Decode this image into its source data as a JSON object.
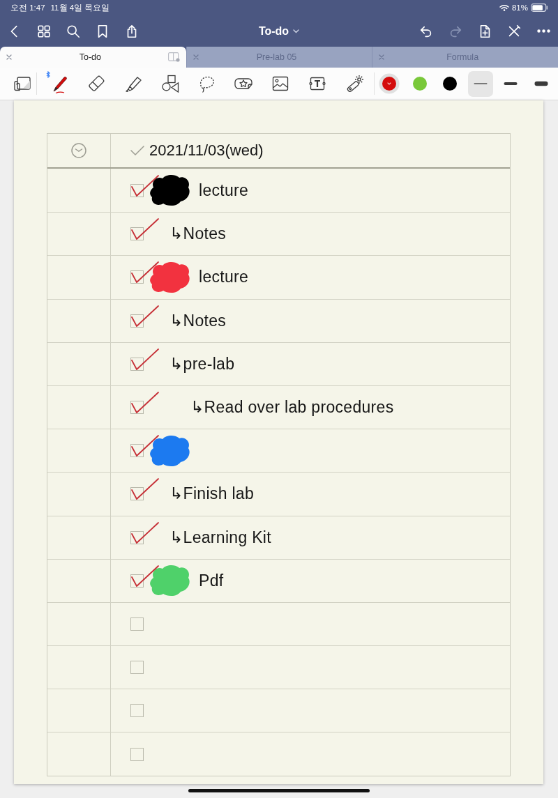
{
  "status_bar": {
    "time": "오전 1:47",
    "date": "11월 4일 목요일",
    "battery": "81%"
  },
  "nav_bar": {
    "title": "To-do",
    "undo": {
      "disabled": false
    },
    "redo": {
      "disabled": true
    }
  },
  "tabs": [
    {
      "label": "To-do",
      "selected": true
    },
    {
      "label": "Pre-lab 05",
      "selected": false
    },
    {
      "label": "Formula",
      "selected": false
    }
  ],
  "toolbar": {
    "tools": [
      {
        "kind": "pen",
        "selected": true
      },
      {
        "kind": "eraser",
        "selected": false
      },
      {
        "kind": "highlighter",
        "selected": false
      },
      {
        "kind": "shapes",
        "selected": false
      },
      {
        "kind": "lasso",
        "selected": false
      },
      {
        "kind": "sticker",
        "selected": false
      },
      {
        "kind": "image",
        "selected": false
      },
      {
        "kind": "text",
        "selected": false
      },
      {
        "kind": "laser",
        "selected": false
      }
    ],
    "colors": [
      {
        "color": "#d40c0c",
        "selected": true
      },
      {
        "color": "#79c83a",
        "selected": false
      },
      {
        "color": "#000000",
        "selected": false
      }
    ],
    "stroke_widths": [
      {
        "selected": true
      },
      {
        "selected": false
      },
      {
        "selected": false
      }
    ]
  },
  "page": {
    "header": {
      "date": "2021/11/03(wed)"
    },
    "tasks": [
      {
        "checked": true,
        "scribble": {
          "color": "#000000"
        },
        "text": "lecture",
        "children": [
          {
            "checked": true,
            "text": "↳Notes"
          }
        ]
      },
      {
        "checked": true,
        "scribble": {
          "color": "#f2323f"
        },
        "text": "lecture",
        "children": [
          {
            "checked": true,
            "text": "↳Notes"
          },
          {
            "checked": true,
            "text": "↳pre-lab",
            "children": [
              {
                "checked": true,
                "text": "↳Read over lab procedures"
              }
            ]
          }
        ]
      },
      {
        "checked": true,
        "scribble": {
          "color": "#1c7af0"
        },
        "children": [
          {
            "checked": true,
            "text": "↳Finish lab"
          },
          {
            "checked": true,
            "text": "↳Learning Kit"
          }
        ]
      },
      {
        "checked": true,
        "scribble": {
          "color": "#4fd16a"
        },
        "text": "Pdf"
      }
    ],
    "blank_rows": [
      {
        "checked": false
      },
      {
        "checked": false
      },
      {
        "checked": false
      },
      {
        "checked": false
      }
    ]
  }
}
